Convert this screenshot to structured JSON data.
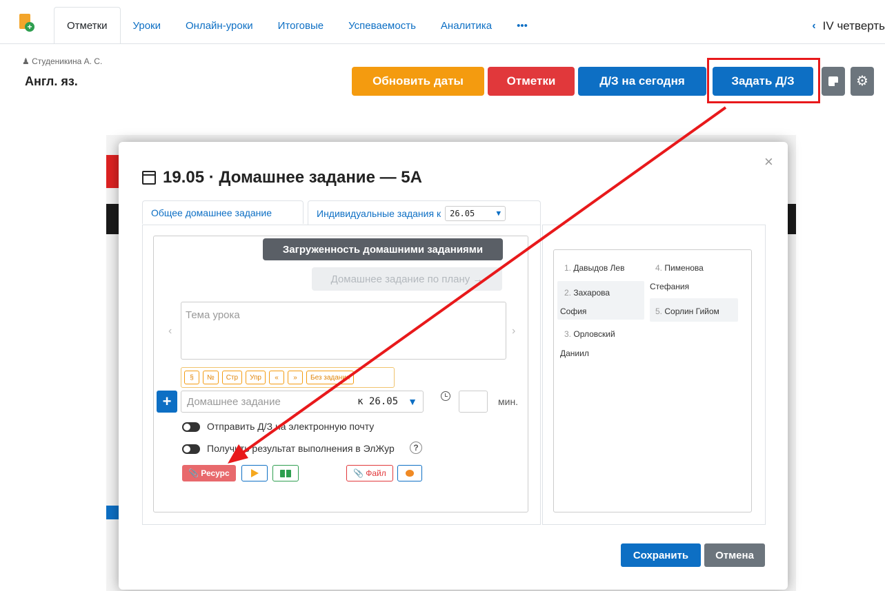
{
  "tabs": [
    {
      "label": "Отметки",
      "active": true
    },
    {
      "label": "Уроки"
    },
    {
      "label": "Онлайн-уроки"
    },
    {
      "label": "Итоговые"
    },
    {
      "label": "Успеваемость"
    },
    {
      "label": "Аналитика"
    },
    {
      "label": "•••"
    }
  ],
  "quarter": {
    "chevron": "‹",
    "label": "IV четверть"
  },
  "teacher": "Студеникина А. С.",
  "subject": "Англ. яз.",
  "toolbar": {
    "update_dates": "Обновить даты",
    "marks": "Отметки",
    "hw_today": "Д/З на сегодня",
    "assign_hw": "Задать Д/З"
  },
  "icons": {
    "note": "note-icon",
    "settings": "gear-icon",
    "calendar": "calendar-icon",
    "clock": "clock-icon",
    "paperclip": "paperclip-icon"
  },
  "colors": {
    "accent": "#0d6fc4",
    "orange": "#f49b0f",
    "red": "#e1383b",
    "highlight": "#e8191b",
    "gray": "#6c757d"
  },
  "modal": {
    "close": "×",
    "title": "19.05 · Домашнее задание — 5А",
    "tab_common": "Общее домашнее задание",
    "tab_individual": "Индивидуальные задания к",
    "individual_date": "26.05",
    "load_button": "Загруженность домашними заданиями",
    "plan_button": "Домашнее задание по плану →",
    "topic_placeholder": "Тема урока",
    "prev": "‹",
    "next": "›",
    "quick_buttons": [
      "§",
      "№",
      "Стр",
      "Упр",
      "«",
      "»",
      "Без задания"
    ],
    "add": "+",
    "hw_placeholder": "Домашнее задание",
    "hw_due": "к 26.05",
    "minutes_label": "мин.",
    "email_toggle": "Отправить Д/З на электронную почту",
    "result_toggle": "Получить результат выполнения в ЭлЖур",
    "help": "?",
    "resource_button": "Ресурс",
    "file_button": "Файл",
    "save": "Сохранить",
    "cancel": "Отмена"
  },
  "students": [
    {
      "num": "1.",
      "name": "Давыдов Лев"
    },
    {
      "num": "2.",
      "name": "Захарова",
      "name2": "София"
    },
    {
      "num": "3.",
      "name": "Орловский",
      "name2": "Даниил"
    },
    {
      "num": "4.",
      "name": "Пименова",
      "name2": "Стефания"
    },
    {
      "num": "5.",
      "name": "Сорлин Гийом"
    }
  ]
}
